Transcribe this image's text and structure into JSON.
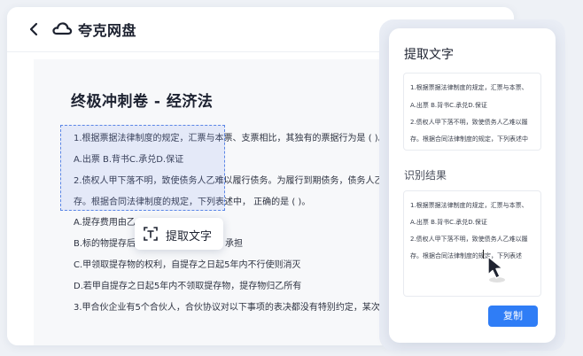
{
  "header": {
    "app_title": "夸克网盘",
    "back_icon": "chevron-left-icon",
    "logo_icon": "cloud-logo-icon"
  },
  "document": {
    "title": "终极冲刺卷 - 经济法",
    "lines": [
      "1.根据票据法律制度的规定，汇票与本票、支票相比，其独有的票据行为是 ( )。",
      "A.出票  B.背书C.承兑D.保证",
      "2.债权人甲下落不明，致使债务人乙难以履行债务。为履行到期债务，债务人乙将标",
      "存。根据合同法律制度的规定，下列表述中，  正确的是 ( )。",
      "A.提存费用由乙",
      "B.标的物提存后,",
      "承担",
      "C.甲领取提存物的权利，自提存之日起5年内不行使则消灭",
      "D.若甲自提存之日起5年内不领取提存物，提存物归乙所有",
      "3.甲合伙企业有5个合伙人，合伙协议对以下事项的表决都没有特别约定，某次召开"
    ]
  },
  "selection_popup": {
    "label": "提取文字",
    "icon": "text-extract-icon"
  },
  "panel": {
    "title": "提取文字",
    "source_lines": [
      "1.根据票据法律制度的规定，汇票与本票、",
      "A.出票  B.背书C.承兑D.保证",
      "2.债权人甲下落不明，致使债务人乙难以履",
      "存。根据合同法律制度的规定，下列表述中"
    ],
    "result_label": "识别结果",
    "result_lines": [
      "1.根据票据法律制度的规定，汇票与本票、",
      "A.出票  B.背书C.承兑D.保证",
      "2.债权人甲下落不明，致使债务人乙难以履",
      "存。根据合同法律制度的规定，下列表述"
    ],
    "copy_label": "复制",
    "cursor_icon": "mouse-pointer-icon"
  },
  "colors": {
    "accent": "#2f7df6",
    "selection": "#5b86e6"
  }
}
